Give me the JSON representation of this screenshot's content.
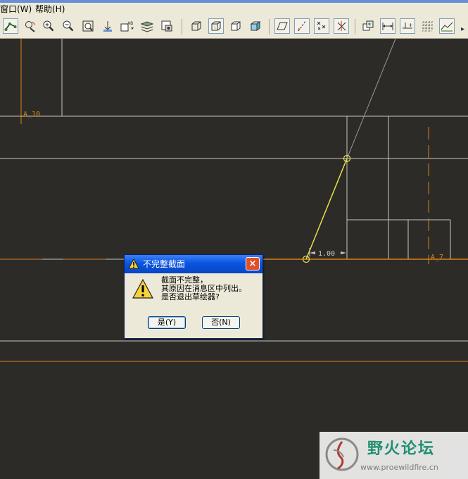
{
  "menu": {
    "items": [
      {
        "label": "窗口(W)"
      },
      {
        "label": "帮助(H)"
      }
    ]
  },
  "toolbar": {
    "buttons": [
      "sketch-icon",
      "repaint-icon",
      "zoom-in-icon",
      "zoom-out-icon",
      "refit-icon",
      "orient-icon",
      "named-view-icon",
      "layers-icon",
      "view-manager-icon",
      "wireframe-icon",
      "hidden-line-icon",
      "no-hidden-icon",
      "shading-icon",
      "datum-planes-icon",
      "datum-axes-icon",
      "datum-points-icon",
      "csys-icon",
      "references-icon",
      "dimension-icon",
      "constraint-icon",
      "grid-icon",
      "sketcher-icon"
    ]
  },
  "canvas": {
    "labels": {
      "axis_a10": "A_10",
      "axis_a7": "A_7",
      "dimension": "1.00"
    },
    "colors": {
      "background": "#2c2b27",
      "geometry": "#c9c7bd",
      "datum": "#d8821e",
      "sketch_line": "#e8e04a"
    }
  },
  "dialog": {
    "title": "不完整截面",
    "message": [
      "截面不完整，",
      "其原因在消息区中列出。",
      "是否退出草绘器?"
    ],
    "yes_label": "是(Y)",
    "no_label": "否(N)"
  },
  "watermark": {
    "title": "野火论坛",
    "url": "www.proewildfire.cn"
  }
}
